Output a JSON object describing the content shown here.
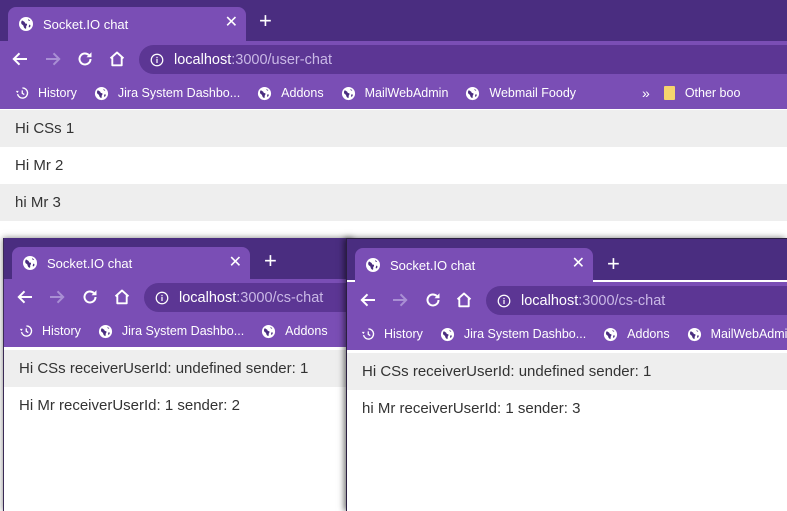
{
  "colors": {
    "tabstrip": "#4a2d80",
    "toolbar": "#7a4eb5",
    "omnibox": "#5c3694",
    "message_alt_row": "#eeeeee",
    "text": "#333333"
  },
  "windows": [
    {
      "tab_title": "Socket.IO chat",
      "url_host": "localhost",
      "url_path": ":3000/user-chat",
      "bookmarks": [
        "History",
        "Jira System Dashbo...",
        "Addons",
        "MailWebAdmin",
        "Webmail Foody"
      ],
      "other_bookmarks": "Other boo",
      "messages": [
        "Hi CSs 1",
        "Hi Mr 2",
        "hi Mr 3"
      ]
    },
    {
      "tab_title": "Socket.IO chat",
      "url_host": "localhost",
      "url_path": ":3000/cs-chat",
      "bookmarks": [
        "History",
        "Jira System Dashbo...",
        "Addons"
      ],
      "messages": [
        "Hi CSs receiverUserId: undefined sender: 1",
        "Hi Mr receiverUserId: 1 sender: 2"
      ]
    },
    {
      "tab_title": "Socket.IO chat",
      "url_host": "localhost",
      "url_path": ":3000/cs-chat",
      "bookmarks": [
        "History",
        "Jira System Dashbo...",
        "Addons",
        "MailWebAdmin"
      ],
      "messages": [
        "Hi CSs receiverUserId: undefined sender: 1",
        "hi Mr receiverUserId: 1 sender: 3"
      ]
    }
  ],
  "icons": {
    "tab_favicon": "globe-icon",
    "close": "close-icon",
    "new_tab": "plus-icon",
    "back": "arrow-left-icon",
    "forward": "arrow-right-icon",
    "reload": "reload-icon",
    "home": "home-icon",
    "site_info": "info-icon",
    "history": "history-icon",
    "bookmark": "globe-icon",
    "overflow": "chevron-double-right-icon",
    "folder": "folder-icon"
  }
}
